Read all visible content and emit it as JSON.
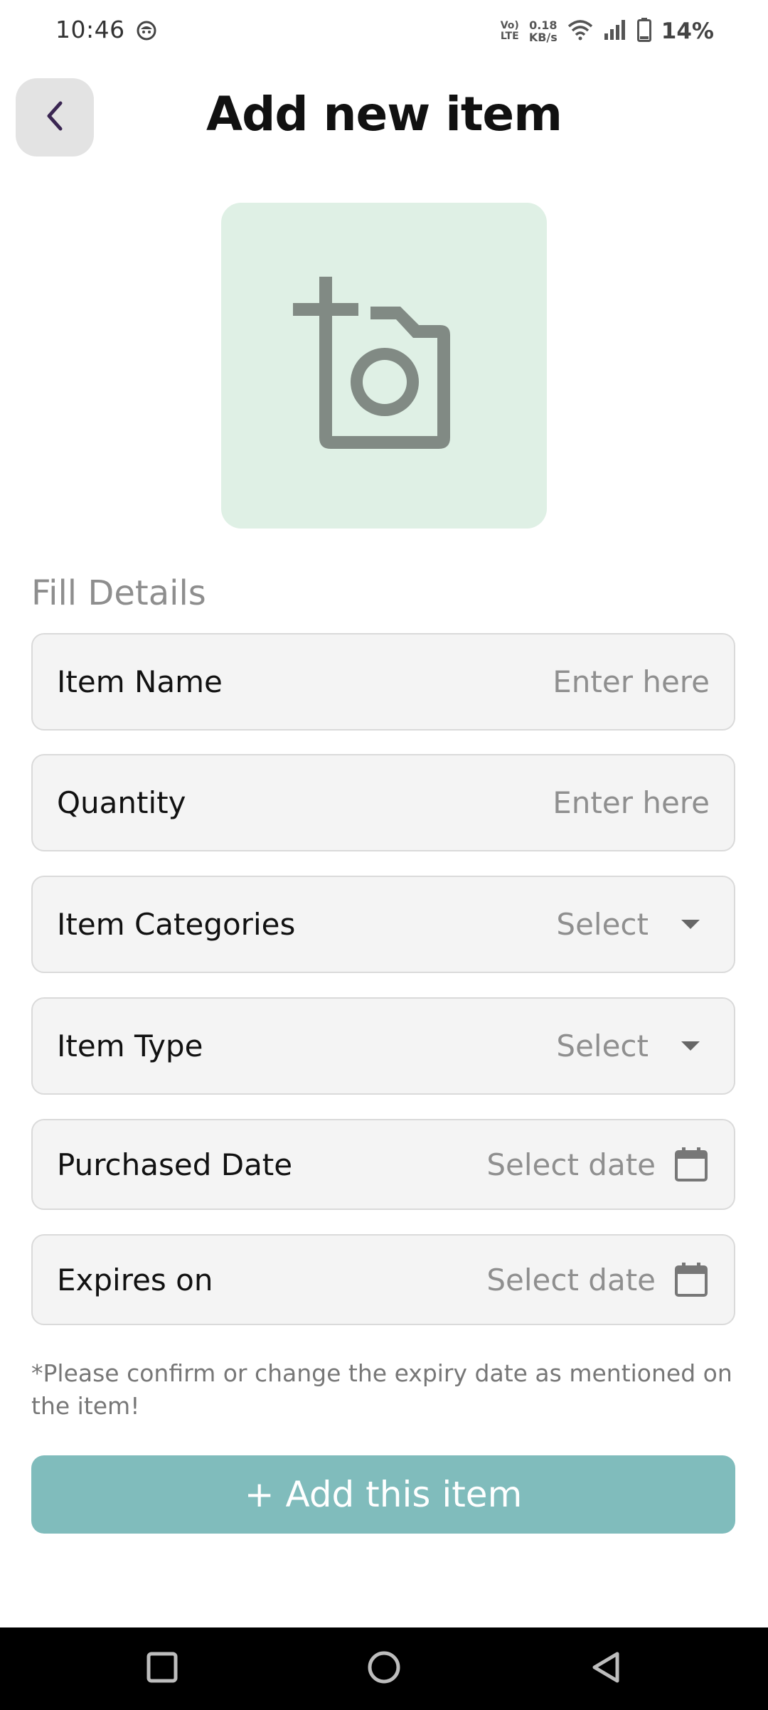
{
  "status_bar": {
    "time": "10:46",
    "volte_line1": "Vo)",
    "volte_line2": "LTE",
    "net_speed_value": "0.18",
    "net_speed_unit": "KB/s",
    "battery_percent": "14%",
    "icons": [
      "app-notification-icon",
      "wifi-icon",
      "signal-icon",
      "battery-icon"
    ]
  },
  "header": {
    "back_icon": "chevron-left-icon",
    "title": "Add new item"
  },
  "photo": {
    "icon": "add-photo-icon",
    "background_color": "#dff0e5",
    "icon_color": "#818a84"
  },
  "form": {
    "section_title": "Fill Details",
    "fields": [
      {
        "label": "Item Name",
        "placeholder": "Enter here",
        "kind": "text"
      },
      {
        "label": "Quantity",
        "placeholder": "Enter here",
        "kind": "text"
      },
      {
        "label": "Item Categories",
        "placeholder": "Select",
        "kind": "dropdown"
      },
      {
        "label": "Item Type",
        "placeholder": "Select",
        "kind": "dropdown"
      },
      {
        "label": "Purchased Date",
        "placeholder": "Select date",
        "kind": "date"
      },
      {
        "label": "Expires on",
        "placeholder": "Select date",
        "kind": "date"
      }
    ],
    "note": "*Please confirm or change the expiry date as mentioned on the item!",
    "submit_label": "+ Add this item",
    "submit_color": "#80bcbc"
  },
  "nav_bar": {
    "icons": [
      "recents-square-icon",
      "home-circle-icon",
      "back-triangle-icon"
    ]
  }
}
